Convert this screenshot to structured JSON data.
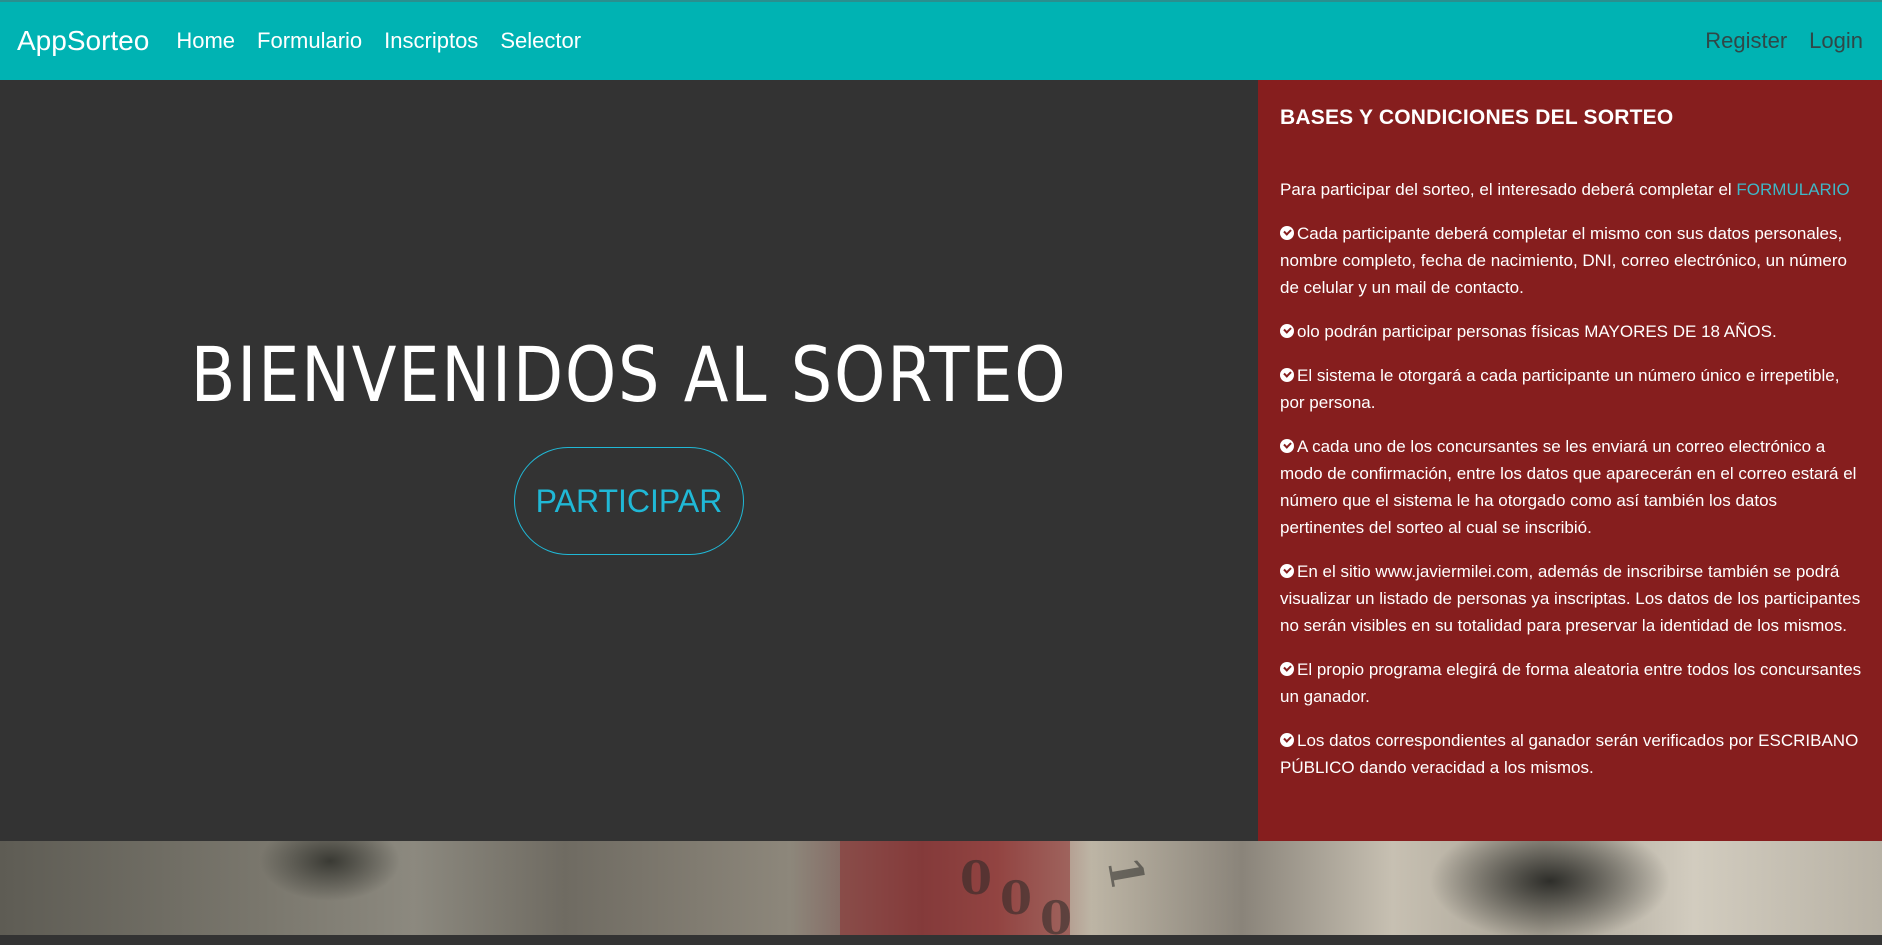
{
  "navbar": {
    "brand": "AppSorteo",
    "links": [
      {
        "label": "Home"
      },
      {
        "label": "Formulario"
      },
      {
        "label": "Inscriptos"
      },
      {
        "label": "Selector"
      }
    ],
    "right_links": [
      {
        "label": "Register"
      },
      {
        "label": "Login"
      }
    ]
  },
  "hero": {
    "title": "BIENVENIDOS AL SORTEO",
    "button_label": "PARTICIPAR"
  },
  "rules": {
    "heading": "BASES Y CONDICIONES DEL SORTEO",
    "intro": "Para participar del sorteo, el interesado deberá completar el ",
    "intro_link": "FORMULARIO",
    "items": [
      "Cada participante deberá completar el mismo con sus datos personales, nombre completo, fecha de nacimiento, DNI, correo electrónico, un número de celular y un mail de contacto.",
      "olo podrán participar personas físicas MAYORES DE 18 AÑOS.",
      "El sistema le otorgará a cada participante un número único e irrepetible, por persona.",
      "A cada uno de los concursantes se les enviará un correo electrónico a modo de confirmación, entre los datos que aparecerán en el correo estará el número que el sistema le ha otorgado como así también los datos pertinentes del sorteo al cual se inscribió.",
      "En el sitio www.javiermilei.com, además de inscribirse también se podrá visualizar un listado de personas ya inscriptas. Los datos de los participantes no serán visibles en su totalidad para preservar la identidad de los mismos.",
      "El propio programa elegirá de forma aleatoria entre todos los concursantes un ganador.",
      "Los datos correspondientes al ganador serán verificados por ESCRIBANO PÚBLICO dando veracidad a los mismos."
    ]
  },
  "background": {
    "digits": [
      "0",
      "0",
      "0",
      "1"
    ]
  },
  "colors": {
    "navbar": "#00b3b3",
    "hero": "#333333",
    "sidebar": "#861e1e",
    "accent": "#20b8d6"
  }
}
